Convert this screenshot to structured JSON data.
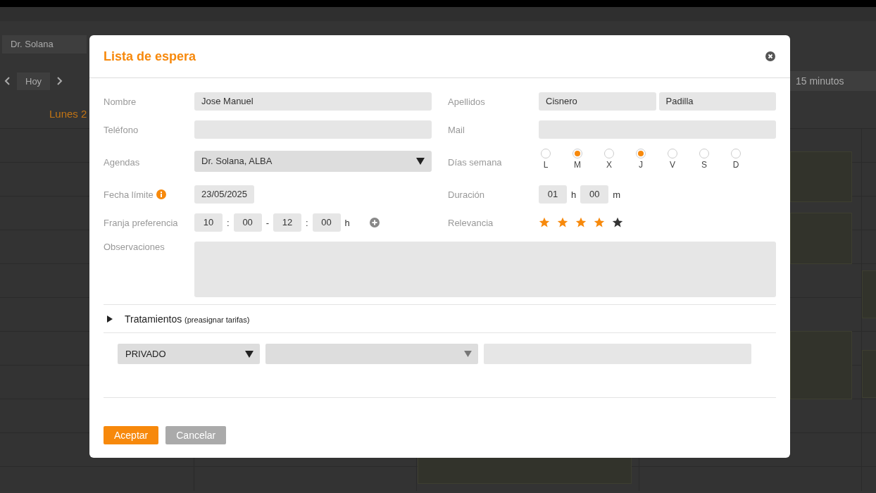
{
  "background": {
    "agenda_select": "Dr. Solana",
    "today_button": "Hoy",
    "day_heading": "Lunes 2",
    "interval_select": "15 minutos"
  },
  "dialog": {
    "title": "Lista de espera",
    "nombre": {
      "label": "Nombre",
      "value": "Jose Manuel"
    },
    "apellidos": {
      "label": "Apellidos",
      "values": [
        "Cisnero",
        "Padilla"
      ]
    },
    "telefono": {
      "label": "Teléfono"
    },
    "mail": {
      "label": "Mail"
    },
    "agendas": {
      "label": "Agendas",
      "value": "Dr. Solana, ALBA"
    },
    "dias_semana": {
      "label": "Días semana",
      "days": [
        {
          "label": "L",
          "checked": false
        },
        {
          "label": "M",
          "checked": true
        },
        {
          "label": "X",
          "checked": false
        },
        {
          "label": "J",
          "checked": true
        },
        {
          "label": "V",
          "checked": false
        },
        {
          "label": "S",
          "checked": false
        },
        {
          "label": "D",
          "checked": false
        }
      ]
    },
    "fecha_limite": {
      "label": "Fecha límite",
      "value": "23/05/2025"
    },
    "duracion": {
      "label": "Duración",
      "hours": "01",
      "hours_unit": "h",
      "minutes": "00",
      "minutes_unit": "m"
    },
    "franja": {
      "label": "Franja preferencia",
      "from_hour": "10",
      "from_minute": "00",
      "to_hour": "12",
      "to_minute": "00",
      "colon": ":",
      "dash": "-",
      "unit": "h"
    },
    "relevancia": {
      "label": "Relevancia",
      "stars": 4
    },
    "observaciones": {
      "label": "Observaciones"
    },
    "tratamientos": {
      "title": "Tratamientos",
      "note": "(preasignar tarifas)",
      "expanded": false,
      "tarifa_select": "PRIVADO"
    },
    "buttons": [
      {
        "label": "Aceptar",
        "kind": "primary"
      },
      {
        "label": "Cancelar",
        "kind": "secondary"
      }
    ]
  }
}
